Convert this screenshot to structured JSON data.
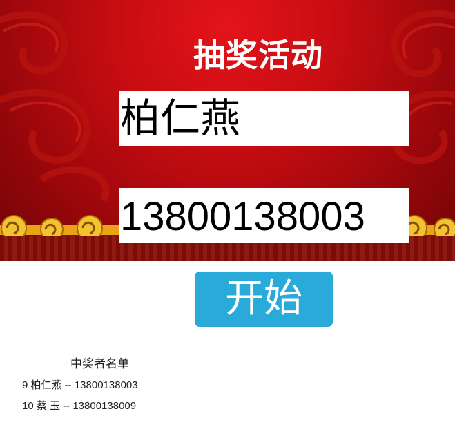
{
  "header": {
    "title": "抽奖活动"
  },
  "lottery": {
    "current_name": "柏仁燕",
    "current_phone": "13800138003",
    "start_label": "开始"
  },
  "winners": {
    "title": "中奖者名单",
    "rows": [
      "9 柏仁燕 -- 13800138003",
      "10 蔡 玉 -- 13800138009"
    ]
  },
  "colors": {
    "banner_red": "#c70d12",
    "button_blue": "#2aaad8",
    "gold": "#e8a317"
  }
}
